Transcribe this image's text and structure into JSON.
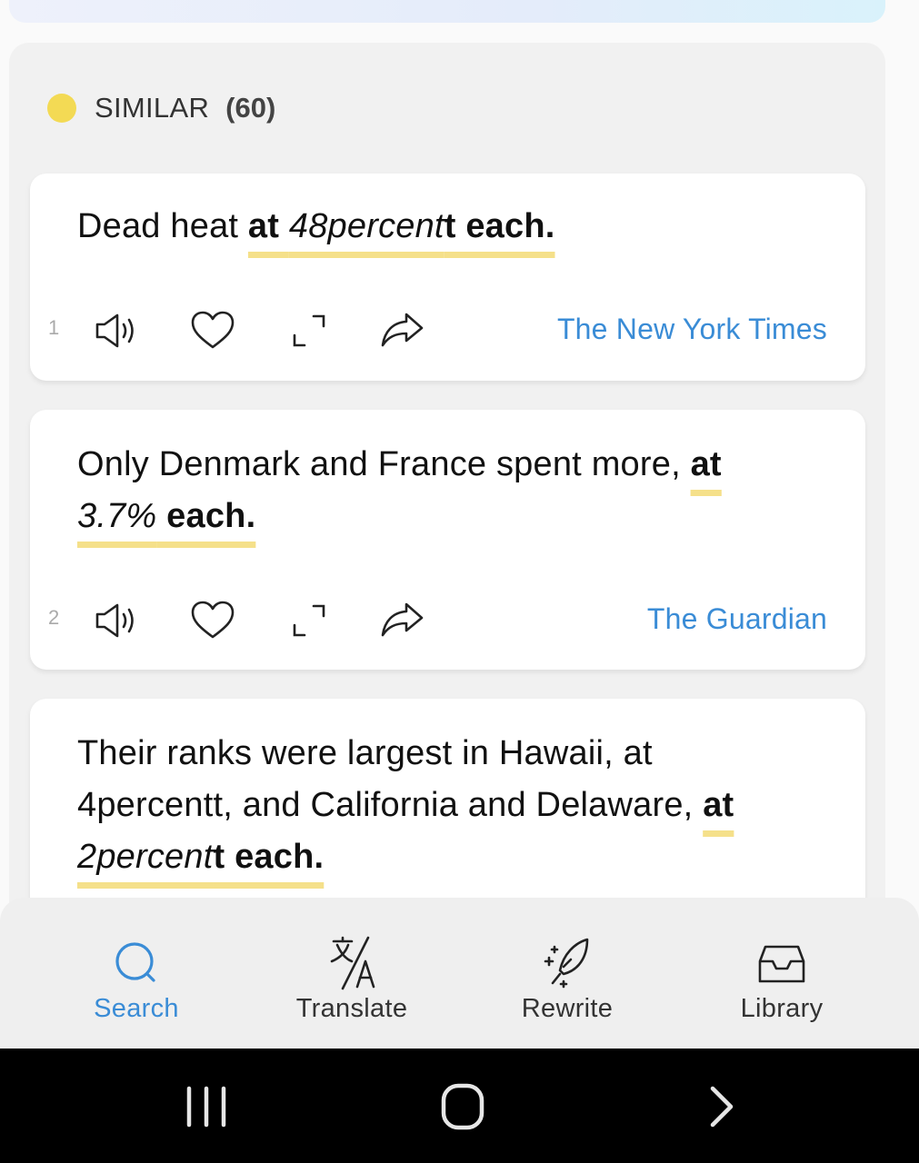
{
  "section": {
    "label": "SIMILAR",
    "count": "(60)",
    "dot_color": "#f3da54"
  },
  "cards": [
    {
      "index": "1",
      "plain": "Dead heat ",
      "hl_a": "at ",
      "hl_i": "48percent",
      "hl_b": "t each.",
      "source": "The New York Times"
    },
    {
      "index": "2",
      "plain": "Only Denmark and France spent more, ",
      "hl_a": "at ",
      "hl_i": "3.7%",
      "hl_b": " each.",
      "source": "The Guardian"
    },
    {
      "plain": "Their ranks were largest in Hawaii, at 4percentt, and California and Delaware, ",
      "hl_a": "at ",
      "hl_i": "2percent",
      "hl_b": "t each."
    }
  ],
  "icons": {
    "speak": "speaker-icon",
    "favorite": "heart-icon",
    "expand": "expand-icon",
    "share": "share-icon"
  },
  "tabs": [
    {
      "label": "Search",
      "icon": "search-icon",
      "active": true
    },
    {
      "label": "Translate",
      "icon": "translate-icon",
      "active": false
    },
    {
      "label": "Rewrite",
      "icon": "rewrite-feather-icon",
      "active": false
    },
    {
      "label": "Library",
      "icon": "inbox-tray-icon",
      "active": false
    }
  ],
  "colors": {
    "accent": "#3a8cd6",
    "highlight": "#f5e08a"
  }
}
